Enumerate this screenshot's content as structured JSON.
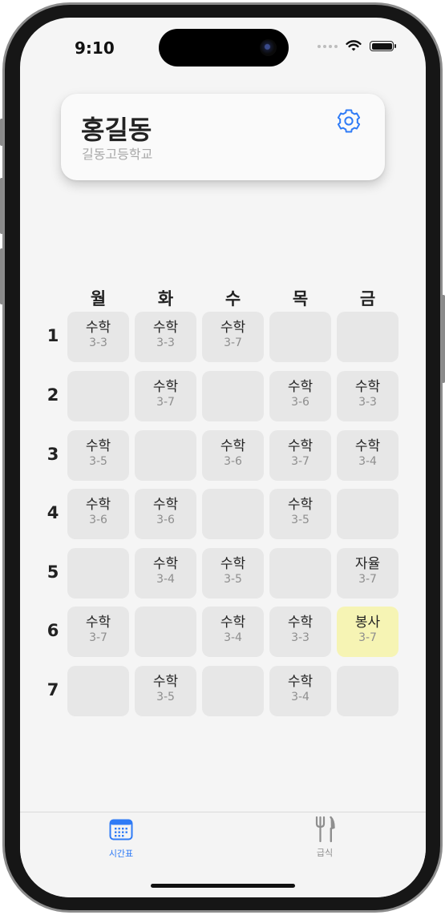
{
  "status": {
    "time": "9:10"
  },
  "profile": {
    "name": "홍길동",
    "school": "길동고등학교"
  },
  "days": [
    "월",
    "화",
    "수",
    "목",
    "금"
  ],
  "periods": [
    "1",
    "2",
    "3",
    "4",
    "5",
    "6",
    "7"
  ],
  "timetable": [
    [
      {
        "subject": "수학",
        "room": "3-3"
      },
      {
        "subject": "수학",
        "room": "3-3"
      },
      {
        "subject": "수학",
        "room": "3-7"
      },
      null,
      null
    ],
    [
      null,
      {
        "subject": "수학",
        "room": "3-7"
      },
      null,
      {
        "subject": "수학",
        "room": "3-6"
      },
      {
        "subject": "수학",
        "room": "3-3"
      }
    ],
    [
      {
        "subject": "수학",
        "room": "3-5"
      },
      null,
      {
        "subject": "수학",
        "room": "3-6"
      },
      {
        "subject": "수학",
        "room": "3-7"
      },
      {
        "subject": "수학",
        "room": "3-4"
      }
    ],
    [
      {
        "subject": "수학",
        "room": "3-6"
      },
      {
        "subject": "수학",
        "room": "3-6"
      },
      null,
      {
        "subject": "수학",
        "room": "3-5"
      },
      null
    ],
    [
      null,
      {
        "subject": "수학",
        "room": "3-4"
      },
      {
        "subject": "수학",
        "room": "3-5"
      },
      null,
      {
        "subject": "자율",
        "room": "3-7"
      }
    ],
    [
      {
        "subject": "수학",
        "room": "3-7"
      },
      null,
      {
        "subject": "수학",
        "room": "3-4"
      },
      {
        "subject": "수학",
        "room": "3-3"
      },
      {
        "subject": "봉사",
        "room": "3-7",
        "highlighted": true
      }
    ],
    [
      null,
      {
        "subject": "수학",
        "room": "3-5"
      },
      null,
      {
        "subject": "수학",
        "room": "3-4"
      },
      null
    ]
  ],
  "tabs": [
    {
      "label": "시간표",
      "icon": "calendar-icon",
      "active": true
    },
    {
      "label": "급식",
      "icon": "fork-knife-icon",
      "active": false
    }
  ],
  "colors": {
    "accent": "#2f7bf6",
    "highlight": "#f6f4b4",
    "cell": "#e7e7e7",
    "inactive_tab": "#8e8e8e"
  }
}
